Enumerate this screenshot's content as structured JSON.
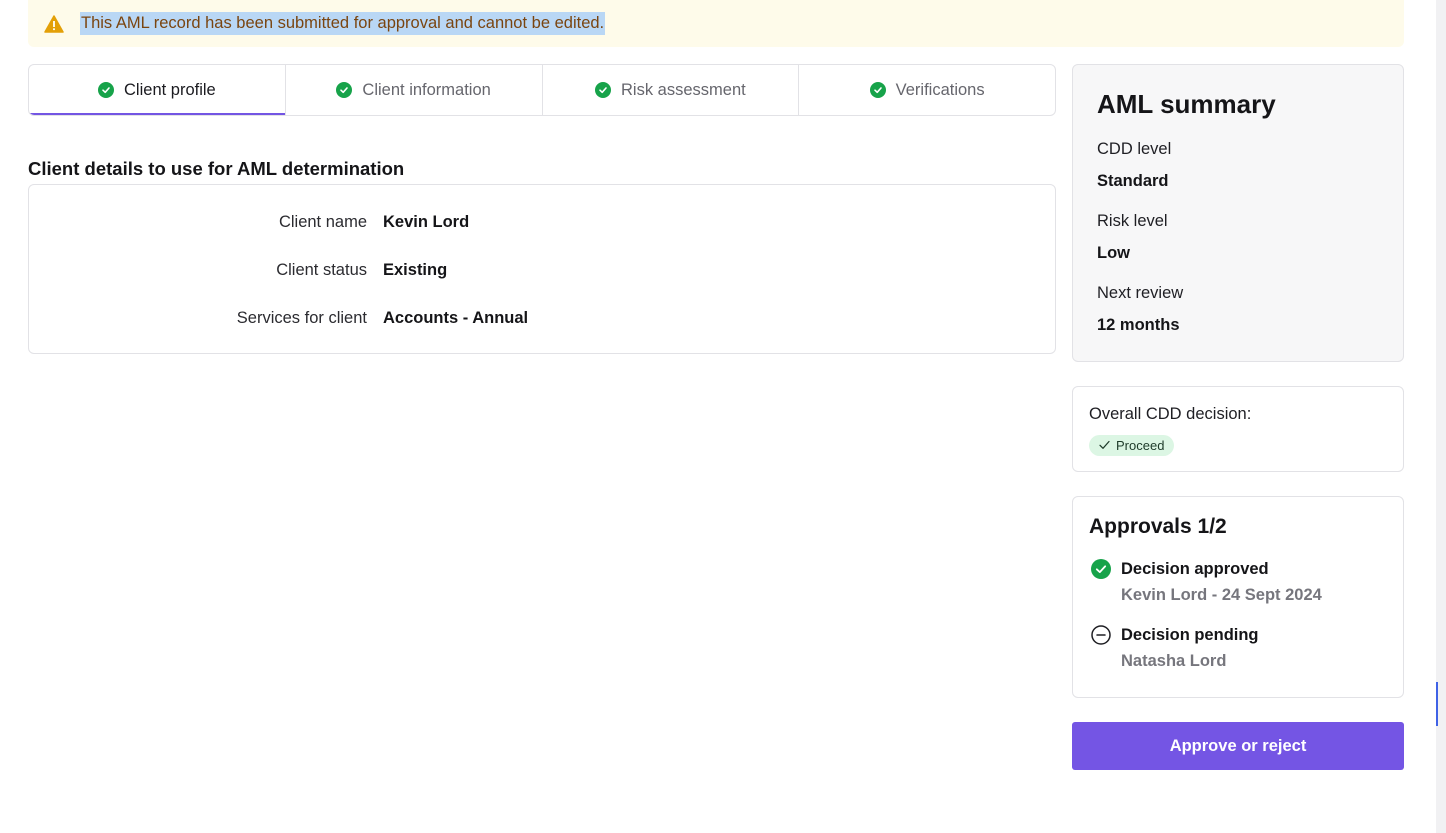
{
  "banner": {
    "icon": "warning-icon",
    "message": "This AML record has been submitted for approval and cannot be edited."
  },
  "tabs": [
    {
      "label": "Client profile",
      "active": true,
      "complete": true
    },
    {
      "label": "Client information",
      "active": false,
      "complete": true
    },
    {
      "label": "Risk assessment",
      "active": false,
      "complete": true
    },
    {
      "label": "Verifications",
      "active": false,
      "complete": true
    }
  ],
  "details": {
    "title": "Client details to use for AML determination",
    "rows": [
      {
        "label": "Client name",
        "value": "Kevin Lord"
      },
      {
        "label": "Client status",
        "value": "Existing"
      },
      {
        "label": "Services for client",
        "value": "Accounts - Annual"
      }
    ]
  },
  "summary": {
    "title": "AML summary",
    "items": [
      {
        "label": "CDD level",
        "value": "Standard"
      },
      {
        "label": "Risk level",
        "value": "Low"
      },
      {
        "label": "Next review",
        "value": "12 months"
      }
    ]
  },
  "cdd": {
    "label": "Overall CDD decision:",
    "badge": "Proceed"
  },
  "approvals": {
    "title": "Approvals 1/2",
    "items": [
      {
        "status": "Decision approved",
        "by": "Kevin Lord - 24 Sept 2024",
        "icon": "check-circle-icon"
      },
      {
        "status": "Decision pending",
        "by": "Natasha Lord",
        "icon": "minus-circle-icon"
      }
    ]
  },
  "actions": {
    "approve_label": "Approve or reject"
  },
  "colors": {
    "accent": "#7455e4",
    "success": "#17a34a",
    "banner_bg": "#fefbea",
    "warning": "#e3a008"
  }
}
